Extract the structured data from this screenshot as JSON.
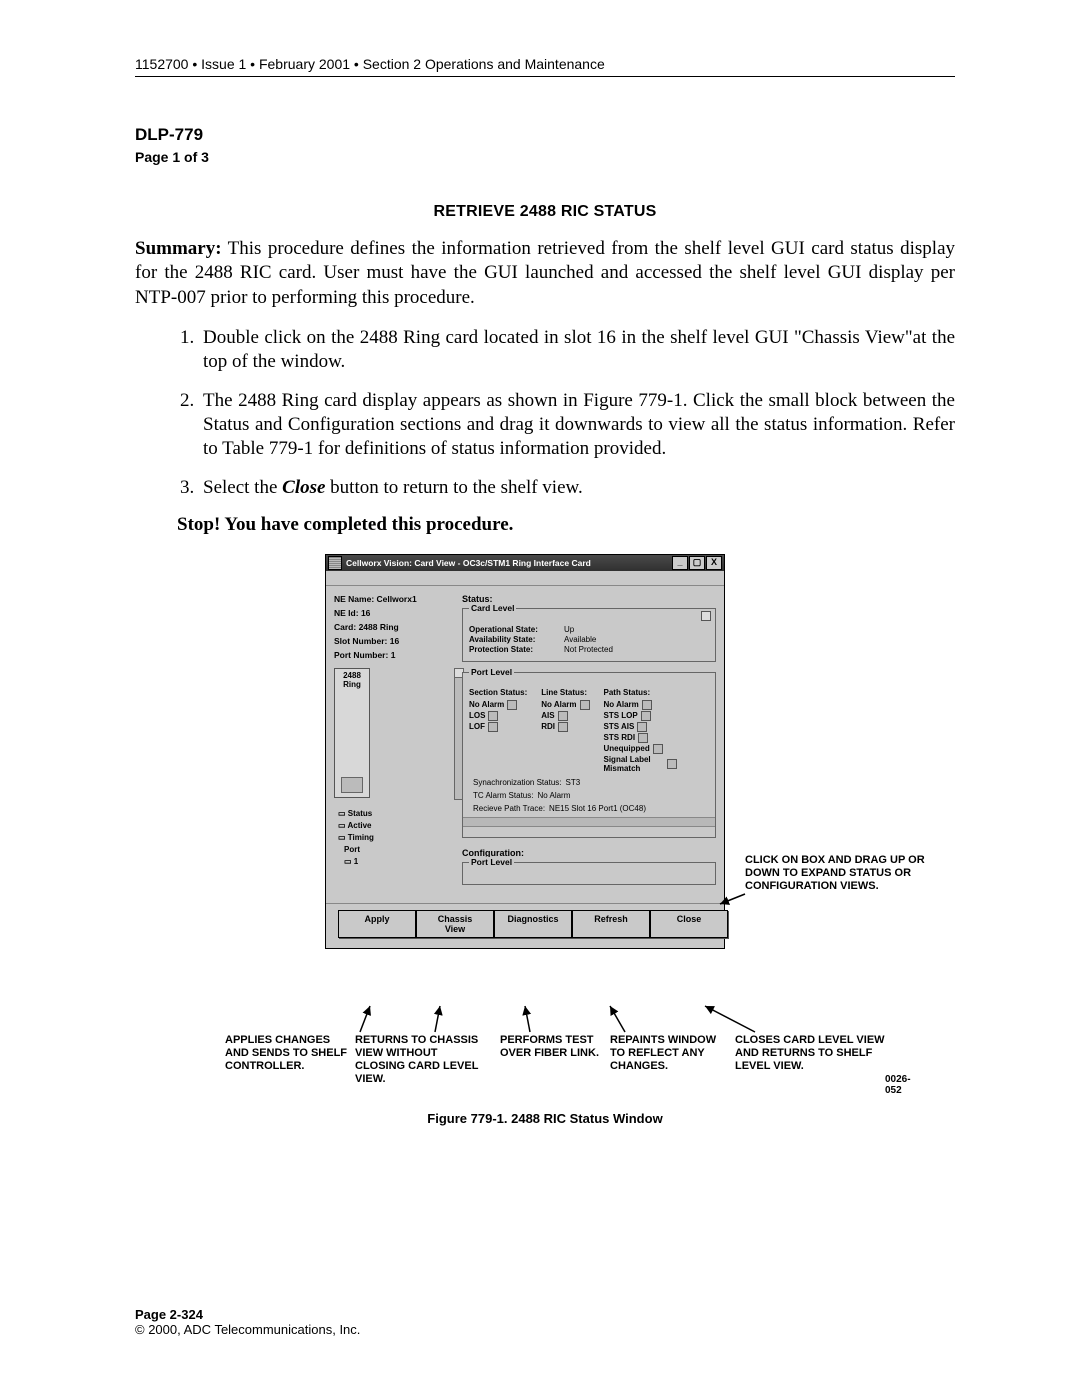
{
  "header": "1152700 • Issue 1 • February 2001 • Section 2 Operations and Maintenance",
  "dlp": {
    "id": "DLP-779",
    "page": "Page 1 of 3"
  },
  "title": "RETRIEVE 2488 RIC STATUS",
  "summary_label": "Summary:",
  "summary": " This procedure defines the information retrieved from the shelf level GUI card status display for the 2488 RIC card. User must have the GUI launched and accessed the shelf level GUI display per NTP-007 prior to performing this procedure.",
  "steps": [
    "Double click on the 2488 Ring card located in slot 16 in the shelf level GUI \"Chassis View\"at the top of the window.",
    "The 2488 Ring card display appears as shown in Figure 779-1. Click the small block between the Status and Configuration sections and drag it downwards to view all the status information. Refer to Table 779-1 for definitions of status information provided."
  ],
  "step3_pre": "Select the ",
  "step3_btn": "Close",
  "step3_post": "  button to return to the shelf view.",
  "stop": "Stop! You have completed this procedure.",
  "gui": {
    "title": "Cellworx Vision:   Card View - OC3c/STM1 Ring Interface Card",
    "ne_name_k": "NE Name:",
    "ne_name_v": "Cellworx1",
    "ne_id_k": "NE Id:",
    "ne_id_v": "16",
    "card_k": "Card:",
    "card_v": "2488 Ring",
    "slot_k": "Slot Number:",
    "slot_v": "16",
    "port_k": "Port Number:",
    "port_v": "1",
    "slot_label": "2488 Ring",
    "tree": [
      "Status",
      "Active",
      "Timing",
      "Port",
      "1"
    ],
    "status_lbl": "Status:",
    "card_level": "Card Level",
    "op_k": "Operational State:",
    "op_v": "Up",
    "av_k": "Availability State:",
    "av_v": "Available",
    "pr_k": "Protection State:",
    "pr_v": "Not Protected",
    "port_level": "Port Level",
    "sec_h": "Section Status:",
    "line_h": "Line Status:",
    "path_h": "Path Status:",
    "sec": [
      "No Alarm",
      "LOS",
      "LOF"
    ],
    "line": [
      "No Alarm",
      "AIS",
      "RDI"
    ],
    "path": [
      "No Alarm",
      "STS LOP",
      "STS AIS",
      "STS RDI",
      "Unequipped",
      "Signal Label Mismatch"
    ],
    "syn_k": "Synachronization Status:",
    "syn_v": "ST3",
    "tc_k": "TC Alarm Status:",
    "tc_v": "No Alarm",
    "rp_k": "Recieve Path Trace:",
    "rp_v": "NE15 Slot 16 Port1 (OC48)",
    "config_lbl": "Configuration:",
    "config_port": "Port Level",
    "buttons": [
      "Apply",
      "Chassis View",
      "Diagnostics",
      "Refresh",
      "Close"
    ]
  },
  "annos": {
    "right": "CLICK ON BOX AND DRAG UP OR DOWN TO EXPAND STATUS OR CONFIGURATION VIEWS.",
    "b1": "APPLIES CHANGES AND SENDS TO SHELF CONTROLLER.",
    "b2": "RETURNS TO CHASSIS VIEW WITHOUT CLOSING CARD LEVEL VIEW.",
    "b3": "PERFORMS TEST OVER FIBER LINK.",
    "b4": "REPAINTS WINDOW TO REFLECT ANY CHANGES.",
    "b5": "CLOSES CARD LEVEL VIEW AND RETURNS TO SHELF LEVEL VIEW.",
    "code": "0026-052"
  },
  "fig_caption": "Figure 779-1. 2488 RIC Status Window",
  "footer": {
    "page": "Page 2-324",
    "copy": "© 2000, ADC Telecommunications, Inc."
  }
}
